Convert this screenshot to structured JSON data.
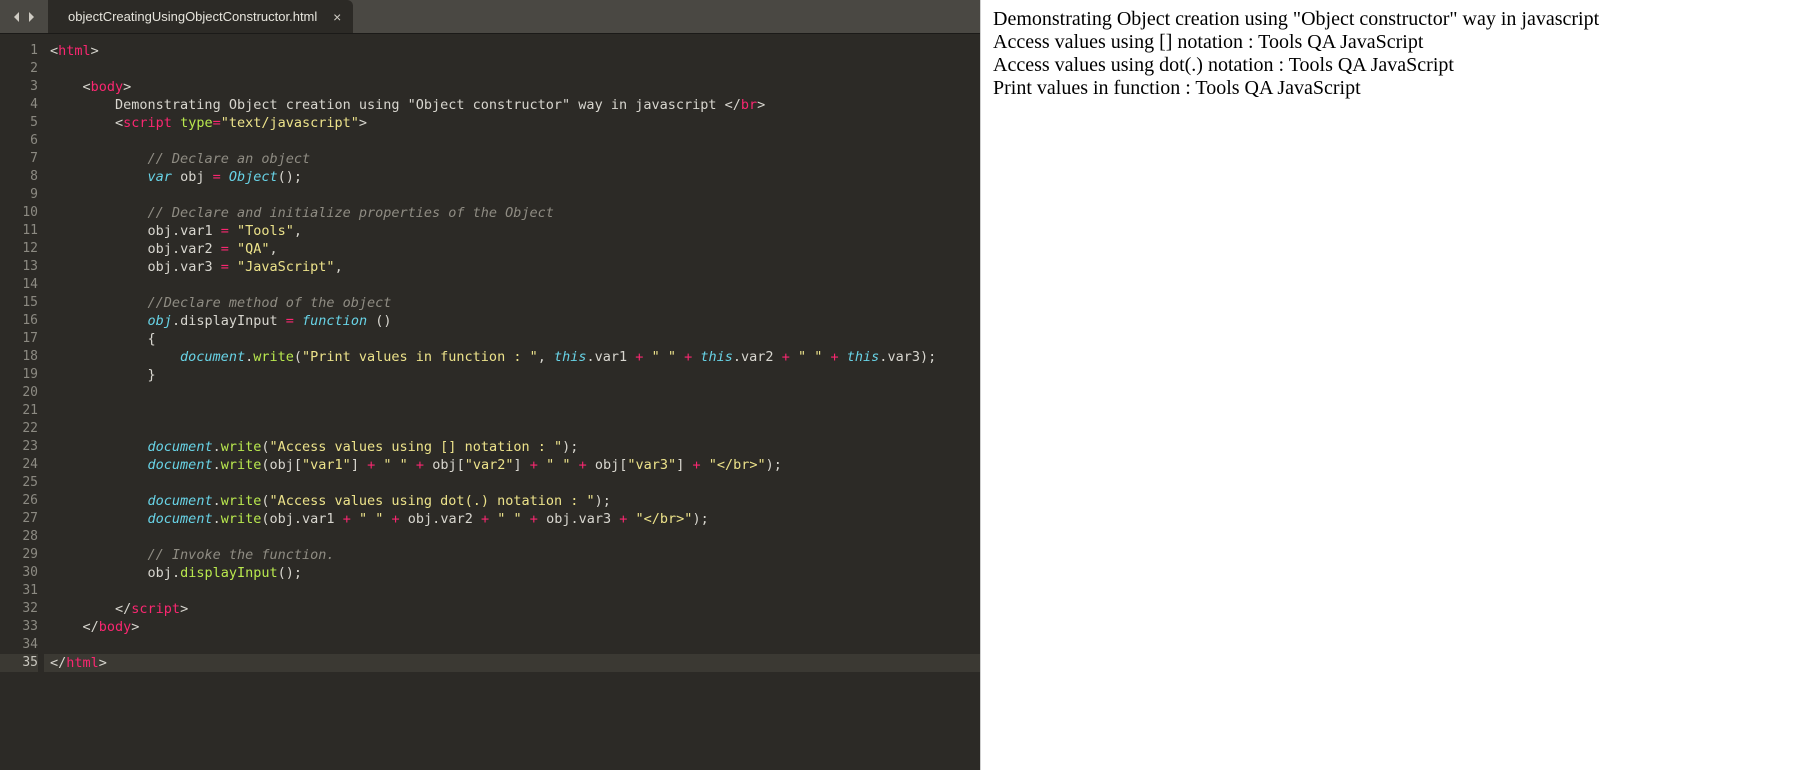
{
  "tab": {
    "title": "objectCreatingUsingObjectConstructor.html",
    "close": "×"
  },
  "lineCount": 35,
  "code": {
    "l1": [
      [
        "ang",
        "<"
      ],
      [
        "tag",
        "html"
      ],
      [
        "ang",
        ">"
      ]
    ],
    "l2": [],
    "l3": [
      [
        "pun",
        "    "
      ],
      [
        "ang",
        "<"
      ],
      [
        "tag",
        "body"
      ],
      [
        "ang",
        ">"
      ]
    ],
    "l4": [
      [
        "pun",
        "        "
      ],
      [
        "id",
        "Demonstrating Object creation using \"Object constructor\" way in javascript "
      ],
      [
        "ang",
        "</"
      ],
      [
        "tag",
        "br"
      ],
      [
        "ang",
        ">"
      ]
    ],
    "l5": [
      [
        "pun",
        "        "
      ],
      [
        "ang",
        "<"
      ],
      [
        "tag",
        "script"
      ],
      [
        "pun",
        " "
      ],
      [
        "attr",
        "type"
      ],
      [
        "eq",
        "="
      ],
      [
        "str",
        "\"text/javascript\""
      ],
      [
        "ang",
        ">"
      ]
    ],
    "l6": [],
    "l7": [
      [
        "pun",
        "            "
      ],
      [
        "cm",
        "// Declare an object"
      ]
    ],
    "l8": [
      [
        "pun",
        "            "
      ],
      [
        "kw",
        "var"
      ],
      [
        "pun",
        " "
      ],
      [
        "id",
        "obj"
      ],
      [
        "pun",
        " "
      ],
      [
        "op",
        "="
      ],
      [
        "pun",
        " "
      ],
      [
        "obj",
        "Object"
      ],
      [
        "pun",
        "();"
      ]
    ],
    "l9": [],
    "l10": [
      [
        "pun",
        "            "
      ],
      [
        "cm",
        "// Declare and initialize properties of the Object"
      ]
    ],
    "l11": [
      [
        "pun",
        "            "
      ],
      [
        "id",
        "obj"
      ],
      [
        "pun",
        "."
      ],
      [
        "id",
        "var1"
      ],
      [
        "pun",
        " "
      ],
      [
        "op",
        "="
      ],
      [
        "pun",
        " "
      ],
      [
        "str",
        "\"Tools\""
      ],
      [
        "pun",
        ","
      ]
    ],
    "l12": [
      [
        "pun",
        "            "
      ],
      [
        "id",
        "obj"
      ],
      [
        "pun",
        "."
      ],
      [
        "id",
        "var2"
      ],
      [
        "pun",
        " "
      ],
      [
        "op",
        "="
      ],
      [
        "pun",
        " "
      ],
      [
        "str",
        "\"QA\""
      ],
      [
        "pun",
        ","
      ]
    ],
    "l13": [
      [
        "pun",
        "            "
      ],
      [
        "id",
        "obj"
      ],
      [
        "pun",
        "."
      ],
      [
        "id",
        "var3"
      ],
      [
        "pun",
        " "
      ],
      [
        "op",
        "="
      ],
      [
        "pun",
        " "
      ],
      [
        "str",
        "\"JavaScript\""
      ],
      [
        "pun",
        ","
      ]
    ],
    "l14": [],
    "l15": [
      [
        "pun",
        "            "
      ],
      [
        "cm",
        "//Declare method of the object"
      ]
    ],
    "l16": [
      [
        "pun",
        "            "
      ],
      [
        "obj",
        "obj"
      ],
      [
        "pun",
        "."
      ],
      [
        "id",
        "displayInput"
      ],
      [
        "pun",
        " "
      ],
      [
        "op",
        "="
      ],
      [
        "pun",
        " "
      ],
      [
        "kw",
        "function"
      ],
      [
        "pun",
        " ()"
      ]
    ],
    "l17": [
      [
        "pun",
        "            "
      ],
      [
        "pun",
        "{"
      ]
    ],
    "l18": [
      [
        "pun",
        "                "
      ],
      [
        "obj",
        "document"
      ],
      [
        "pun",
        "."
      ],
      [
        "fn",
        "write"
      ],
      [
        "pun",
        "("
      ],
      [
        "str",
        "\"Print values in function : \""
      ],
      [
        "pun",
        ", "
      ],
      [
        "this",
        "this"
      ],
      [
        "pun",
        "."
      ],
      [
        "id",
        "var1"
      ],
      [
        "pun",
        " "
      ],
      [
        "op",
        "+"
      ],
      [
        "pun",
        " "
      ],
      [
        "str",
        "\" \""
      ],
      [
        "pun",
        " "
      ],
      [
        "op",
        "+"
      ],
      [
        "pun",
        " "
      ],
      [
        "this",
        "this"
      ],
      [
        "pun",
        "."
      ],
      [
        "id",
        "var2"
      ],
      [
        "pun",
        " "
      ],
      [
        "op",
        "+"
      ],
      [
        "pun",
        " "
      ],
      [
        "str",
        "\" \""
      ],
      [
        "pun",
        " "
      ],
      [
        "op",
        "+"
      ],
      [
        "pun",
        " "
      ],
      [
        "this",
        "this"
      ],
      [
        "pun",
        "."
      ],
      [
        "id",
        "var3"
      ],
      [
        "pun",
        ");"
      ]
    ],
    "l19": [
      [
        "pun",
        "            "
      ],
      [
        "pun",
        "}"
      ]
    ],
    "l20": [],
    "l21": [],
    "l22": [],
    "l23": [
      [
        "pun",
        "            "
      ],
      [
        "obj",
        "document"
      ],
      [
        "pun",
        "."
      ],
      [
        "fn",
        "write"
      ],
      [
        "pun",
        "("
      ],
      [
        "str",
        "\"Access values using [] notation : \""
      ],
      [
        "pun",
        ");"
      ]
    ],
    "l24": [
      [
        "pun",
        "            "
      ],
      [
        "obj",
        "document"
      ],
      [
        "pun",
        "."
      ],
      [
        "fn",
        "write"
      ],
      [
        "pun",
        "("
      ],
      [
        "id",
        "obj"
      ],
      [
        "pun",
        "["
      ],
      [
        "str",
        "\"var1\""
      ],
      [
        "pun",
        "]"
      ],
      [
        "pun",
        " "
      ],
      [
        "op",
        "+"
      ],
      [
        "pun",
        " "
      ],
      [
        "str",
        "\" \""
      ],
      [
        "pun",
        " "
      ],
      [
        "op",
        "+"
      ],
      [
        "pun",
        " "
      ],
      [
        "id",
        "obj"
      ],
      [
        "pun",
        "["
      ],
      [
        "str",
        "\"var2\""
      ],
      [
        "pun",
        "]"
      ],
      [
        "pun",
        " "
      ],
      [
        "op",
        "+"
      ],
      [
        "pun",
        " "
      ],
      [
        "str",
        "\" \""
      ],
      [
        "pun",
        " "
      ],
      [
        "op",
        "+"
      ],
      [
        "pun",
        " "
      ],
      [
        "id",
        "obj"
      ],
      [
        "pun",
        "["
      ],
      [
        "str",
        "\"var3\""
      ],
      [
        "pun",
        "]"
      ],
      [
        "pun",
        " "
      ],
      [
        "op",
        "+"
      ],
      [
        "pun",
        " "
      ],
      [
        "str",
        "\"</br>\""
      ],
      [
        "pun",
        ");"
      ]
    ],
    "l25": [],
    "l26": [
      [
        "pun",
        "            "
      ],
      [
        "obj",
        "document"
      ],
      [
        "pun",
        "."
      ],
      [
        "fn",
        "write"
      ],
      [
        "pun",
        "("
      ],
      [
        "str",
        "\"Access values using dot(.) notation : \""
      ],
      [
        "pun",
        ");"
      ]
    ],
    "l27": [
      [
        "pun",
        "            "
      ],
      [
        "obj",
        "document"
      ],
      [
        "pun",
        "."
      ],
      [
        "fn",
        "write"
      ],
      [
        "pun",
        "("
      ],
      [
        "id",
        "obj"
      ],
      [
        "pun",
        "."
      ],
      [
        "id",
        "var1"
      ],
      [
        "pun",
        " "
      ],
      [
        "op",
        "+"
      ],
      [
        "pun",
        " "
      ],
      [
        "str",
        "\" \""
      ],
      [
        "pun",
        " "
      ],
      [
        "op",
        "+"
      ],
      [
        "pun",
        " "
      ],
      [
        "id",
        "obj"
      ],
      [
        "pun",
        "."
      ],
      [
        "id",
        "var2"
      ],
      [
        "pun",
        " "
      ],
      [
        "op",
        "+"
      ],
      [
        "pun",
        " "
      ],
      [
        "str",
        "\" \""
      ],
      [
        "pun",
        " "
      ],
      [
        "op",
        "+"
      ],
      [
        "pun",
        " "
      ],
      [
        "id",
        "obj"
      ],
      [
        "pun",
        "."
      ],
      [
        "id",
        "var3"
      ],
      [
        "pun",
        " "
      ],
      [
        "op",
        "+"
      ],
      [
        "pun",
        " "
      ],
      [
        "str",
        "\"</br>\""
      ],
      [
        "pun",
        ");"
      ]
    ],
    "l28": [],
    "l29": [
      [
        "pun",
        "            "
      ],
      [
        "cm",
        "// Invoke the function."
      ]
    ],
    "l30": [
      [
        "pun",
        "            "
      ],
      [
        "id",
        "obj"
      ],
      [
        "pun",
        "."
      ],
      [
        "fn",
        "displayInput"
      ],
      [
        "pun",
        "();"
      ]
    ],
    "l31": [],
    "l32": [
      [
        "pun",
        "        "
      ],
      [
        "ang",
        "</"
      ],
      [
        "tag",
        "script"
      ],
      [
        "ang",
        ">"
      ]
    ],
    "l33": [
      [
        "pun",
        "    "
      ],
      [
        "ang",
        "</"
      ],
      [
        "tag",
        "body"
      ],
      [
        "ang",
        ">"
      ]
    ],
    "l34": [],
    "l35": [
      [
        "ang",
        "</"
      ],
      [
        "tag",
        "html"
      ],
      [
        "ang",
        ">"
      ]
    ]
  },
  "activeLine": 35,
  "output": {
    "line1": "Demonstrating Object creation using \"Object constructor\" way in javascript",
    "line2": "Access values using [] notation : Tools QA JavaScript",
    "line3": "Access values using dot(.) notation : Tools QA JavaScript",
    "line4": "Print values in function : Tools QA JavaScript"
  }
}
